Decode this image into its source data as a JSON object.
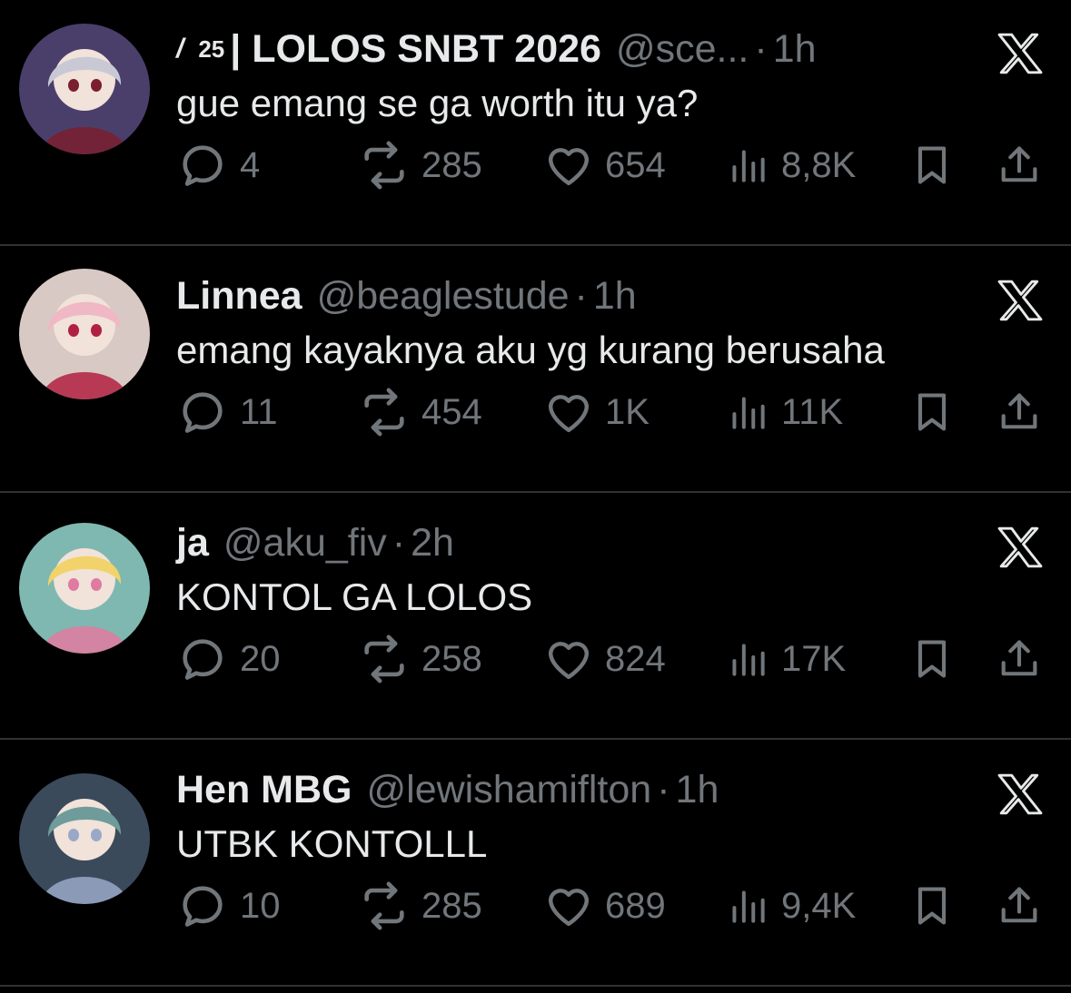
{
  "tweets": [
    {
      "name_prefix": "/",
      "name_sup": "25",
      "name": "| LOLOS SNBT 2026",
      "handle": "@sce...",
      "separator": "·",
      "time": "1h",
      "text": "gue emang se ga worth itu ya?",
      "replies": "4",
      "reposts": "285",
      "likes": "654",
      "views": "8,8K",
      "avatar_colors": [
        "#4a3f6b",
        "#c9c9d6",
        "#7a1f2e"
      ]
    },
    {
      "name": "Linnea",
      "handle": "@beaglestude",
      "separator": "·",
      "time": "1h",
      "text": "emang kayaknya aku yg kurang berusaha",
      "replies": "11",
      "reposts": "454",
      "likes": "1K",
      "views": "11K",
      "avatar_colors": [
        "#d9c9c4",
        "#f0b8c4",
        "#b02040"
      ]
    },
    {
      "name": "ja",
      "handle": "@aku_fiv",
      "separator": "·",
      "time": "2h",
      "text": "KONTOL GA LOLOS",
      "replies": "20",
      "reposts": "258",
      "likes": "824",
      "views": "17K",
      "avatar_colors": [
        "#7fb8b0",
        "#f2d36b",
        "#e07aa0"
      ]
    },
    {
      "name": "Hen  MBG",
      "handle": "@lewishamiflton",
      "separator": "·",
      "time": "1h",
      "text": "UTBK KONTOLLL",
      "replies": "10",
      "reposts": "285",
      "likes": "689",
      "views": "9,4K",
      "avatar_colors": [
        "#3a4a5a",
        "#6f9c9a",
        "#9aa8c8"
      ]
    }
  ],
  "icons": {
    "reply": "reply-icon",
    "repost": "repost-icon",
    "like": "heart-icon",
    "views": "views-icon",
    "bookmark": "bookmark-icon",
    "share": "share-icon",
    "logo": "x-logo-icon"
  },
  "colors": {
    "background": "#000000",
    "text": "#e7e9ea",
    "muted": "#71767b",
    "divider": "#2f3336"
  }
}
